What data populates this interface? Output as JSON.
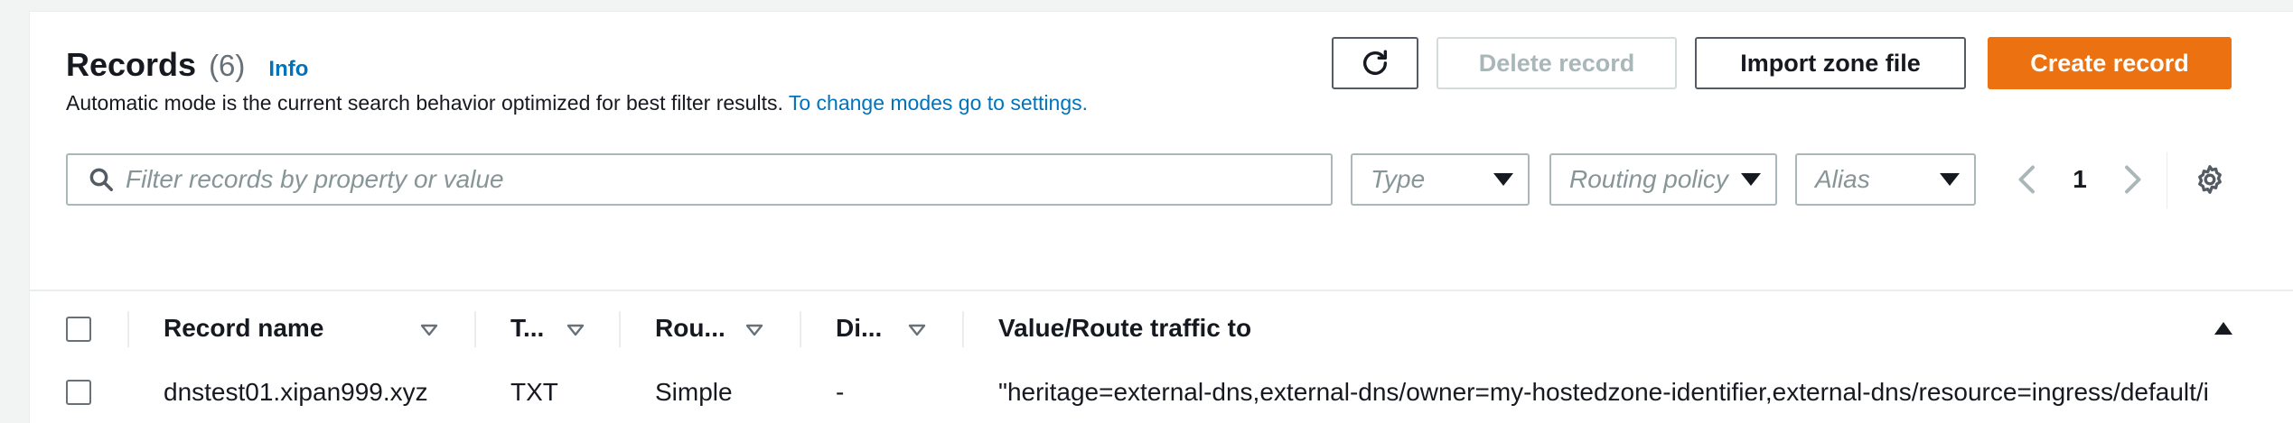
{
  "header": {
    "title": "Records",
    "count": "(6)",
    "info_link": "Info",
    "description": "Automatic mode is the current search behavior optimized for best filter results.",
    "settings_link": "To change modes go to settings."
  },
  "toolbar": {
    "refresh_icon": "refresh-icon",
    "delete_label": "Delete record",
    "import_label": "Import zone file",
    "create_label": "Create record"
  },
  "filters": {
    "search_placeholder": "Filter records by property or value",
    "type_placeholder": "Type",
    "routing_placeholder": "Routing policy",
    "alias_placeholder": "Alias"
  },
  "pagination": {
    "current_page": "1"
  },
  "colors": {
    "primary": "#ec7211",
    "link": "#0073bb",
    "border": "#aab7b8"
  },
  "table": {
    "columns": [
      {
        "label": "Record name"
      },
      {
        "label": "T..."
      },
      {
        "label": "Rou..."
      },
      {
        "label": "Di..."
      },
      {
        "label": "Value/Route traffic to"
      }
    ],
    "rows": [
      {
        "record_name": "dnstest01.xipan999.xyz",
        "type": "TXT",
        "routing": "Simple",
        "differentiator": "-",
        "value": "\"heritage=external-dns,external-dns/owner=my-hostedzone-identifier,external-dns/resource=ingress/default/i"
      }
    ]
  }
}
